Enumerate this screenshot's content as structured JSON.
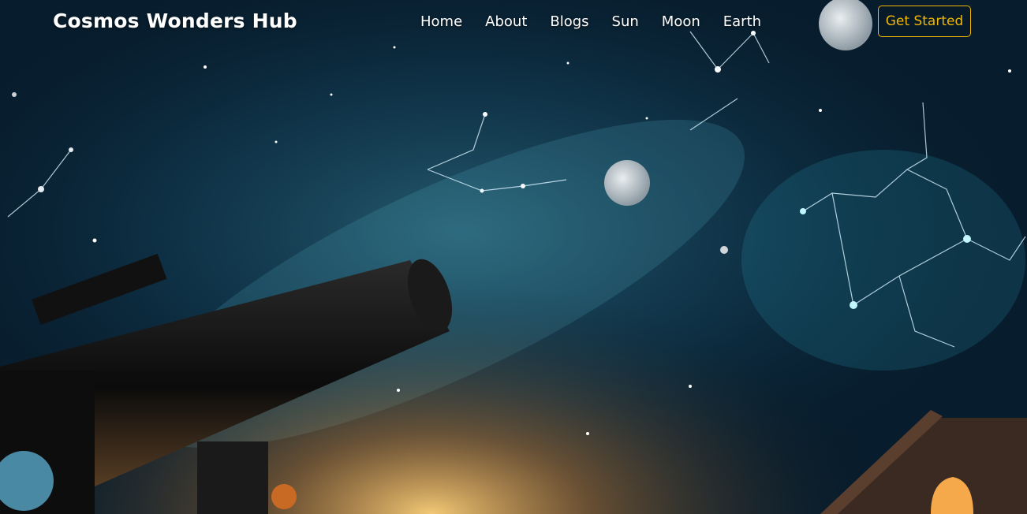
{
  "brand": {
    "title": "Cosmos Wonders Hub"
  },
  "nav": {
    "items": [
      {
        "label": "Home"
      },
      {
        "label": "About"
      },
      {
        "label": "Blogs"
      },
      {
        "label": "Sun"
      },
      {
        "label": "Moon"
      },
      {
        "label": "Earth"
      }
    ]
  },
  "cta": {
    "label": "Get Started"
  },
  "hero": {
    "image": "starry-sky-telescope-illustration"
  },
  "colors": {
    "accent": "#f2b705",
    "nav_text": "#ffffff",
    "sky_dark": "#061826",
    "sky_glow": "#2fa7c4"
  }
}
